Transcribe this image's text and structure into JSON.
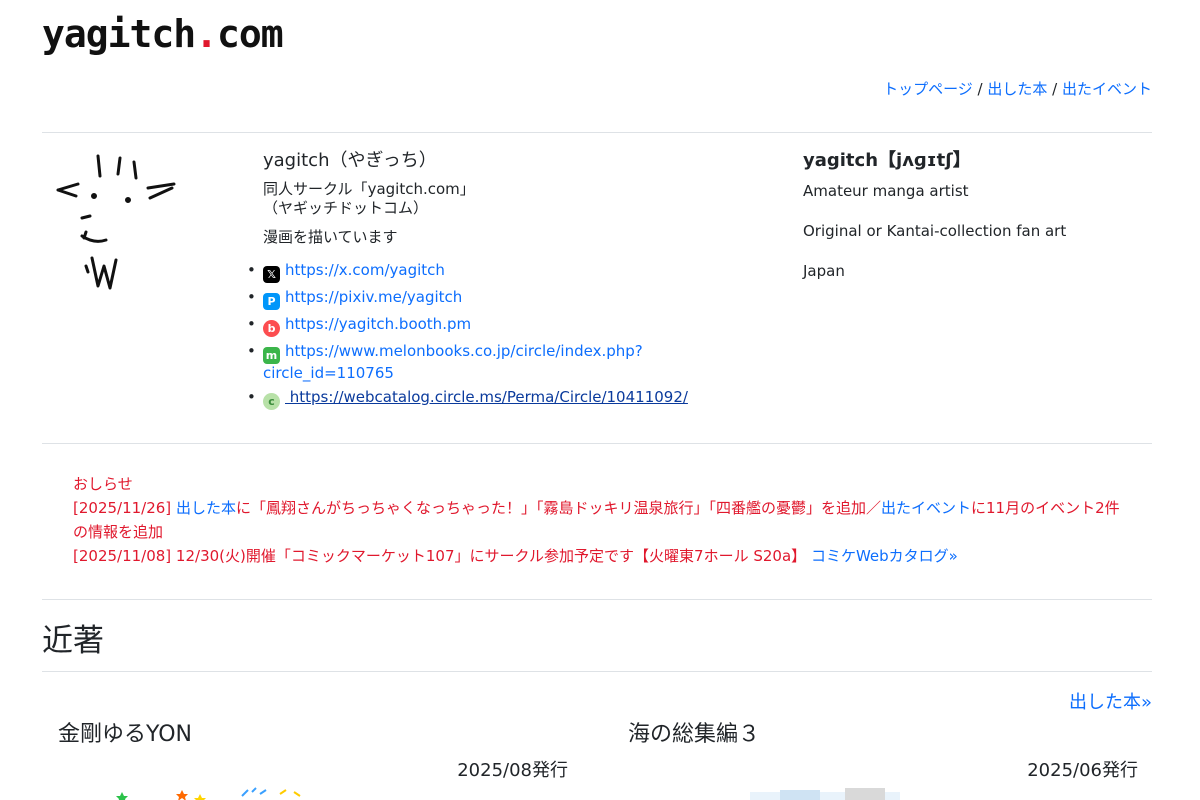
{
  "site": {
    "title_main": "yagitch",
    "title_dot": ".",
    "title_tld": "com"
  },
  "nav": {
    "items": [
      "トップページ",
      "出した本",
      "出たイベント"
    ],
    "separator": " / "
  },
  "profile": {
    "name": "yagitch（やぎっち）",
    "circle_line1_prefix": "同人サークル「",
    "circle_name": "yagitch.com",
    "circle_line1_suffix": "」",
    "circle_line2": "（ヤギッチドットコム）",
    "description": "漫画を描いています",
    "links": [
      {
        "icon": "x-icon",
        "text": "https://x.com/yagitch"
      },
      {
        "icon": "pixiv-icon",
        "text": "https://pixiv.me/yagitch"
      },
      {
        "icon": "booth-icon",
        "text": "https://yagitch.booth.pm"
      },
      {
        "icon": "melonbooks-icon",
        "text": "https://www.melonbooks.co.jp/circle/index.php?",
        "text2": "circle_id=110765"
      },
      {
        "icon": "circle-ms-icon",
        "text": " https://webcatalog.circle.ms/Perma/Circle/10411092/"
      }
    ]
  },
  "english": {
    "name": "yagitch【jʌɡɪtʃ】",
    "lines": [
      "Amateur manga artist",
      "Original or Kantai-collection fan art",
      "Japan"
    ]
  },
  "news": {
    "heading": "おしらせ",
    "item1": {
      "date": "[2025/11/26] ",
      "link1": "出した本",
      "text1": "に「鳳翔さんがちっちゃくなっちゃった！」「霧島ドッキリ温泉旅行」「四番艦の憂鬱」を追加／",
      "link2": "出たイベント",
      "text2": "に11月のイベント2件の情報を追加"
    },
    "item2": {
      "text": "[2025/11/08] 12/30(火)開催「コミックマーケット107」にサークル参加予定です【火曜東7ホール S20a】 ",
      "link": "コミケWebカタログ»"
    }
  },
  "recent": {
    "heading": "近著",
    "more_link": "出した本»",
    "books": [
      {
        "title": "金剛ゆるYON",
        "date": "2025/08発行"
      },
      {
        "title": "海の総集編３",
        "date": "2025/06発行"
      }
    ]
  },
  "colors": {
    "link": "#0d6efd",
    "news": "#e0182d",
    "title_dot": "#e0182d"
  }
}
